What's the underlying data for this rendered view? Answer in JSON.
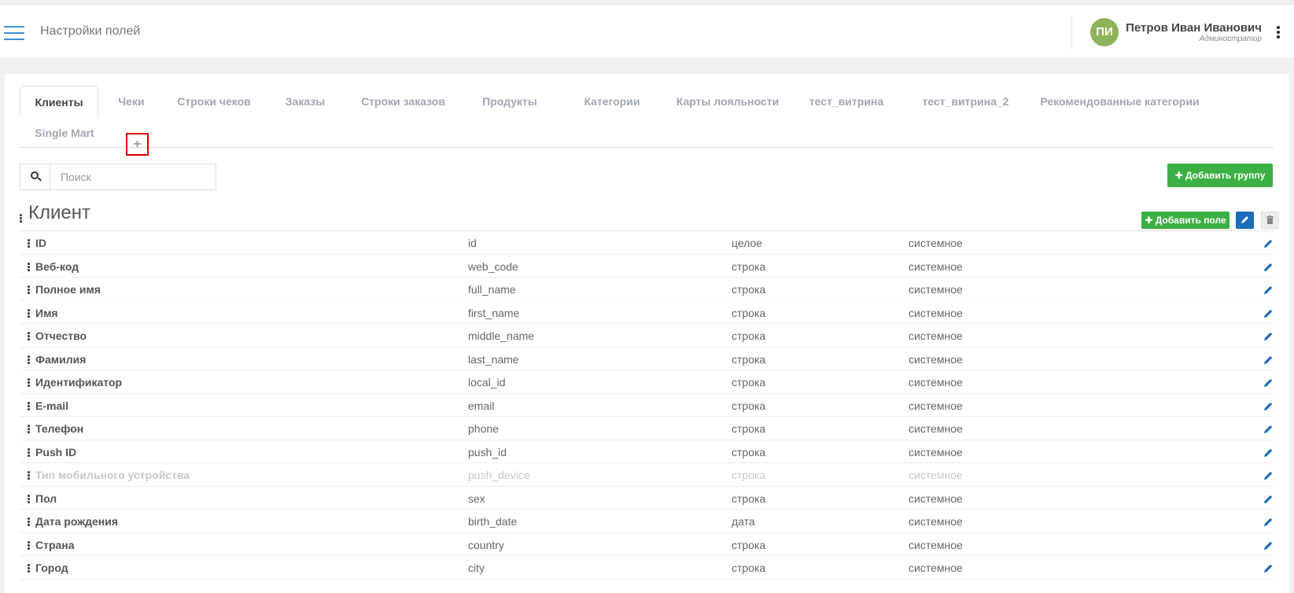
{
  "header": {
    "title": "Настройки полей",
    "user": {
      "initials": "ПИ",
      "name": "Петров Иван Иванович",
      "role": "Администратор",
      "avatar_color": "#8fb35b"
    }
  },
  "tabs": [
    {
      "label": "Клиенты",
      "active": true
    },
    {
      "label": "Чеки"
    },
    {
      "label": "Строки чеков"
    },
    {
      "label": "Заказы"
    },
    {
      "label": "Строки заказов"
    },
    {
      "label": "Продукты"
    },
    {
      "label": "Категории"
    },
    {
      "label": "Карты лояльности"
    },
    {
      "label": "тест_витрина"
    },
    {
      "label": "тест_витрина_2"
    },
    {
      "label": "Рекомендованные категории"
    },
    {
      "label": "Single Mart"
    }
  ],
  "tab_add_label": "+",
  "search": {
    "placeholder": "Поиск",
    "value": ""
  },
  "buttons": {
    "add_group": "✚ Добавить группу",
    "add_field": "✚ Добавить поле"
  },
  "colors": {
    "accent_green": "#3cb044",
    "accent_blue": "#1c6cb8",
    "highlight": "#e00000"
  },
  "group": {
    "title": "Клиент",
    "fields": [
      {
        "label": "ID",
        "key": "id",
        "type": "целое",
        "kind": "системное"
      },
      {
        "label": "Веб-код",
        "key": "web_code",
        "type": "строка",
        "kind": "системное"
      },
      {
        "label": "Полное имя",
        "key": "full_name",
        "type": "строка",
        "kind": "системное"
      },
      {
        "label": "Имя",
        "key": "first_name",
        "type": "строка",
        "kind": "системное"
      },
      {
        "label": "Отчество",
        "key": "middle_name",
        "type": "строка",
        "kind": "системное"
      },
      {
        "label": "Фамилия",
        "key": "last_name",
        "type": "строка",
        "kind": "системное"
      },
      {
        "label": "Идентификатор",
        "key": "local_id",
        "type": "строка",
        "kind": "системное"
      },
      {
        "label": "E-mail",
        "key": "email",
        "type": "строка",
        "kind": "системное"
      },
      {
        "label": "Телефон",
        "key": "phone",
        "type": "строка",
        "kind": "системное"
      },
      {
        "label": "Push ID",
        "key": "push_id",
        "type": "строка",
        "kind": "системное"
      },
      {
        "label": "Тип мобильного устройства",
        "key": "push_device",
        "type": "строка",
        "kind": "системное",
        "disabled": true
      },
      {
        "label": "Пол",
        "key": "sex",
        "type": "строка",
        "kind": "системное"
      },
      {
        "label": "Дата рождения",
        "key": "birth_date",
        "type": "дата",
        "kind": "системное"
      },
      {
        "label": "Страна",
        "key": "country",
        "type": "строка",
        "kind": "системное"
      },
      {
        "label": "Город",
        "key": "city",
        "type": "строка",
        "kind": "системное"
      }
    ]
  }
}
